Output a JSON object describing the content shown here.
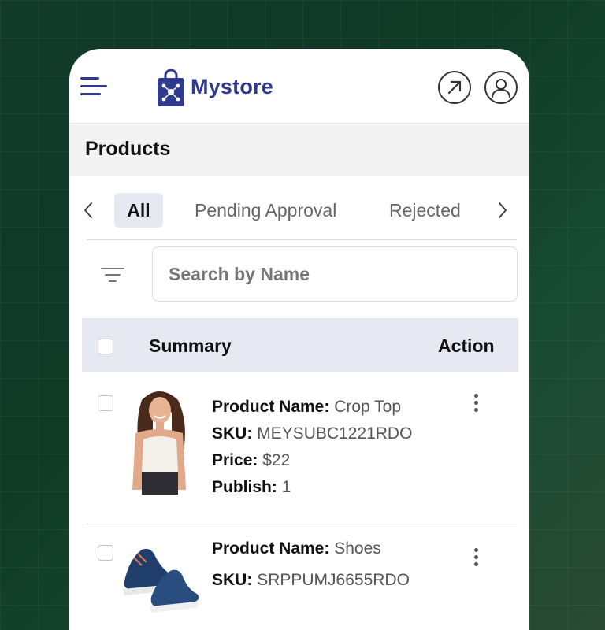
{
  "header": {
    "brand": "Mystore",
    "brand_color": "#2f3a8c",
    "menu_icon": "hamburger-menu-icon",
    "external_icon": "external-link-icon",
    "user_icon": "user-icon"
  },
  "page": {
    "title": "Products"
  },
  "tabs": {
    "items": [
      {
        "label": "All",
        "active": true
      },
      {
        "label": "Pending Approval",
        "active": false
      },
      {
        "label": "Rejected",
        "active": false
      }
    ]
  },
  "search": {
    "placeholder": "Search by Name",
    "value": ""
  },
  "table": {
    "columns": [
      "Summary",
      "Action"
    ],
    "rows": [
      {
        "name_label": "Product Name:",
        "name": "Crop Top",
        "sku_label": "SKU:",
        "sku": "MEYSUBC1221RDO",
        "price_label": "Price:",
        "price": "$22",
        "publish_label": "Publish:",
        "publish": "1"
      },
      {
        "name_label": "Product Name:",
        "name": "Shoes",
        "sku_label": "SKU:",
        "sku": "SRPPUMJ6655RDO"
      }
    ]
  }
}
